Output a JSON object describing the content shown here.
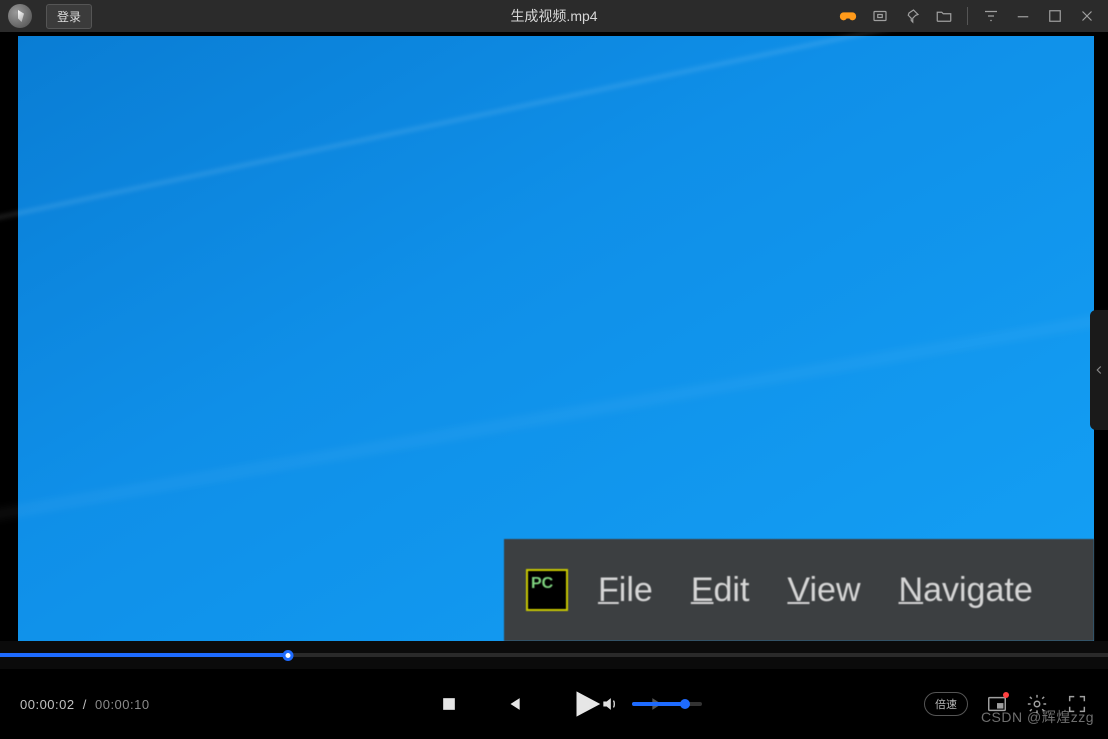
{
  "titlebar": {
    "login_label": "登录",
    "filename": "生成视频.mp4"
  },
  "video_content": {
    "app_icon_text": "PC",
    "menu": {
      "file": "File",
      "edit": "Edit",
      "view": "View",
      "navigate": "Navigate"
    }
  },
  "playback": {
    "current_time": "00:00:02",
    "duration": "00:00:10",
    "progress_percent": 26,
    "volume_percent": 75,
    "speed_label": "倍速"
  },
  "watermark": "CSDN @辉煌zzg"
}
